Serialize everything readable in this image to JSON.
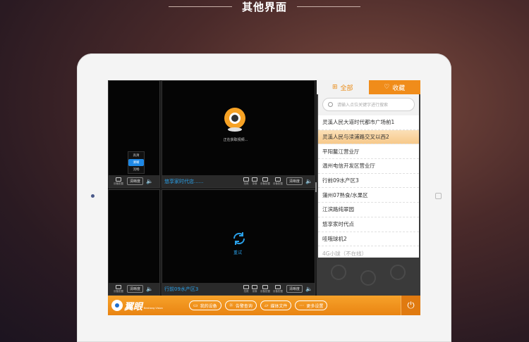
{
  "heading": "其他界面",
  "cells": {
    "top_left": {
      "quality_label": "清晰度",
      "tools": [
        "设备配置"
      ]
    },
    "top_right": {
      "name": "悠享家时代店......",
      "loading_text": "正在获取视频...",
      "tools": [
        "拍照",
        "录像",
        "设备配置",
        "设备配置"
      ],
      "quality_label": "清晰度"
    },
    "bottom_left": {
      "quality_label": "清晰度",
      "tools": [
        "设备配置"
      ]
    },
    "bottom_right": {
      "name": "行前09水产区3",
      "retry_text": "重试",
      "tools": [
        "拍照",
        "录像",
        "设备配置",
        "设备配置"
      ],
      "quality_label": "清晰度"
    }
  },
  "quality_menu": {
    "options": [
      "高清",
      "清晰",
      "流畅"
    ],
    "selected": "清晰"
  },
  "panel": {
    "tab_all": "全部",
    "tab_favorites": "收藏",
    "search_placeholder": "请输入点位关键字进行搜索",
    "items": [
      "灵溪人民大道时代都市广场前1",
      "灵溪人民与渎浦路交叉以西2",
      "平阳鳌江营业厅",
      "温州电信开发区营业厅",
      "行前09水产区3",
      "蒲州07熟食/水果区",
      "江滨路纯翠园",
      "悠享家时代点",
      "哇哦球机2",
      "4G小球（不在线）"
    ],
    "selected_index": 1,
    "offline_index": 9
  },
  "bottom_bar": {
    "brand": "翼眼",
    "brand_sub": "Bestlong Vision",
    "buttons": [
      "我的设备",
      "告警查询",
      "媒体文件",
      "更多设置"
    ]
  },
  "colors": {
    "accent": "#f08c1a",
    "link": "#2aa0e8",
    "selected": "#1e88e5"
  }
}
